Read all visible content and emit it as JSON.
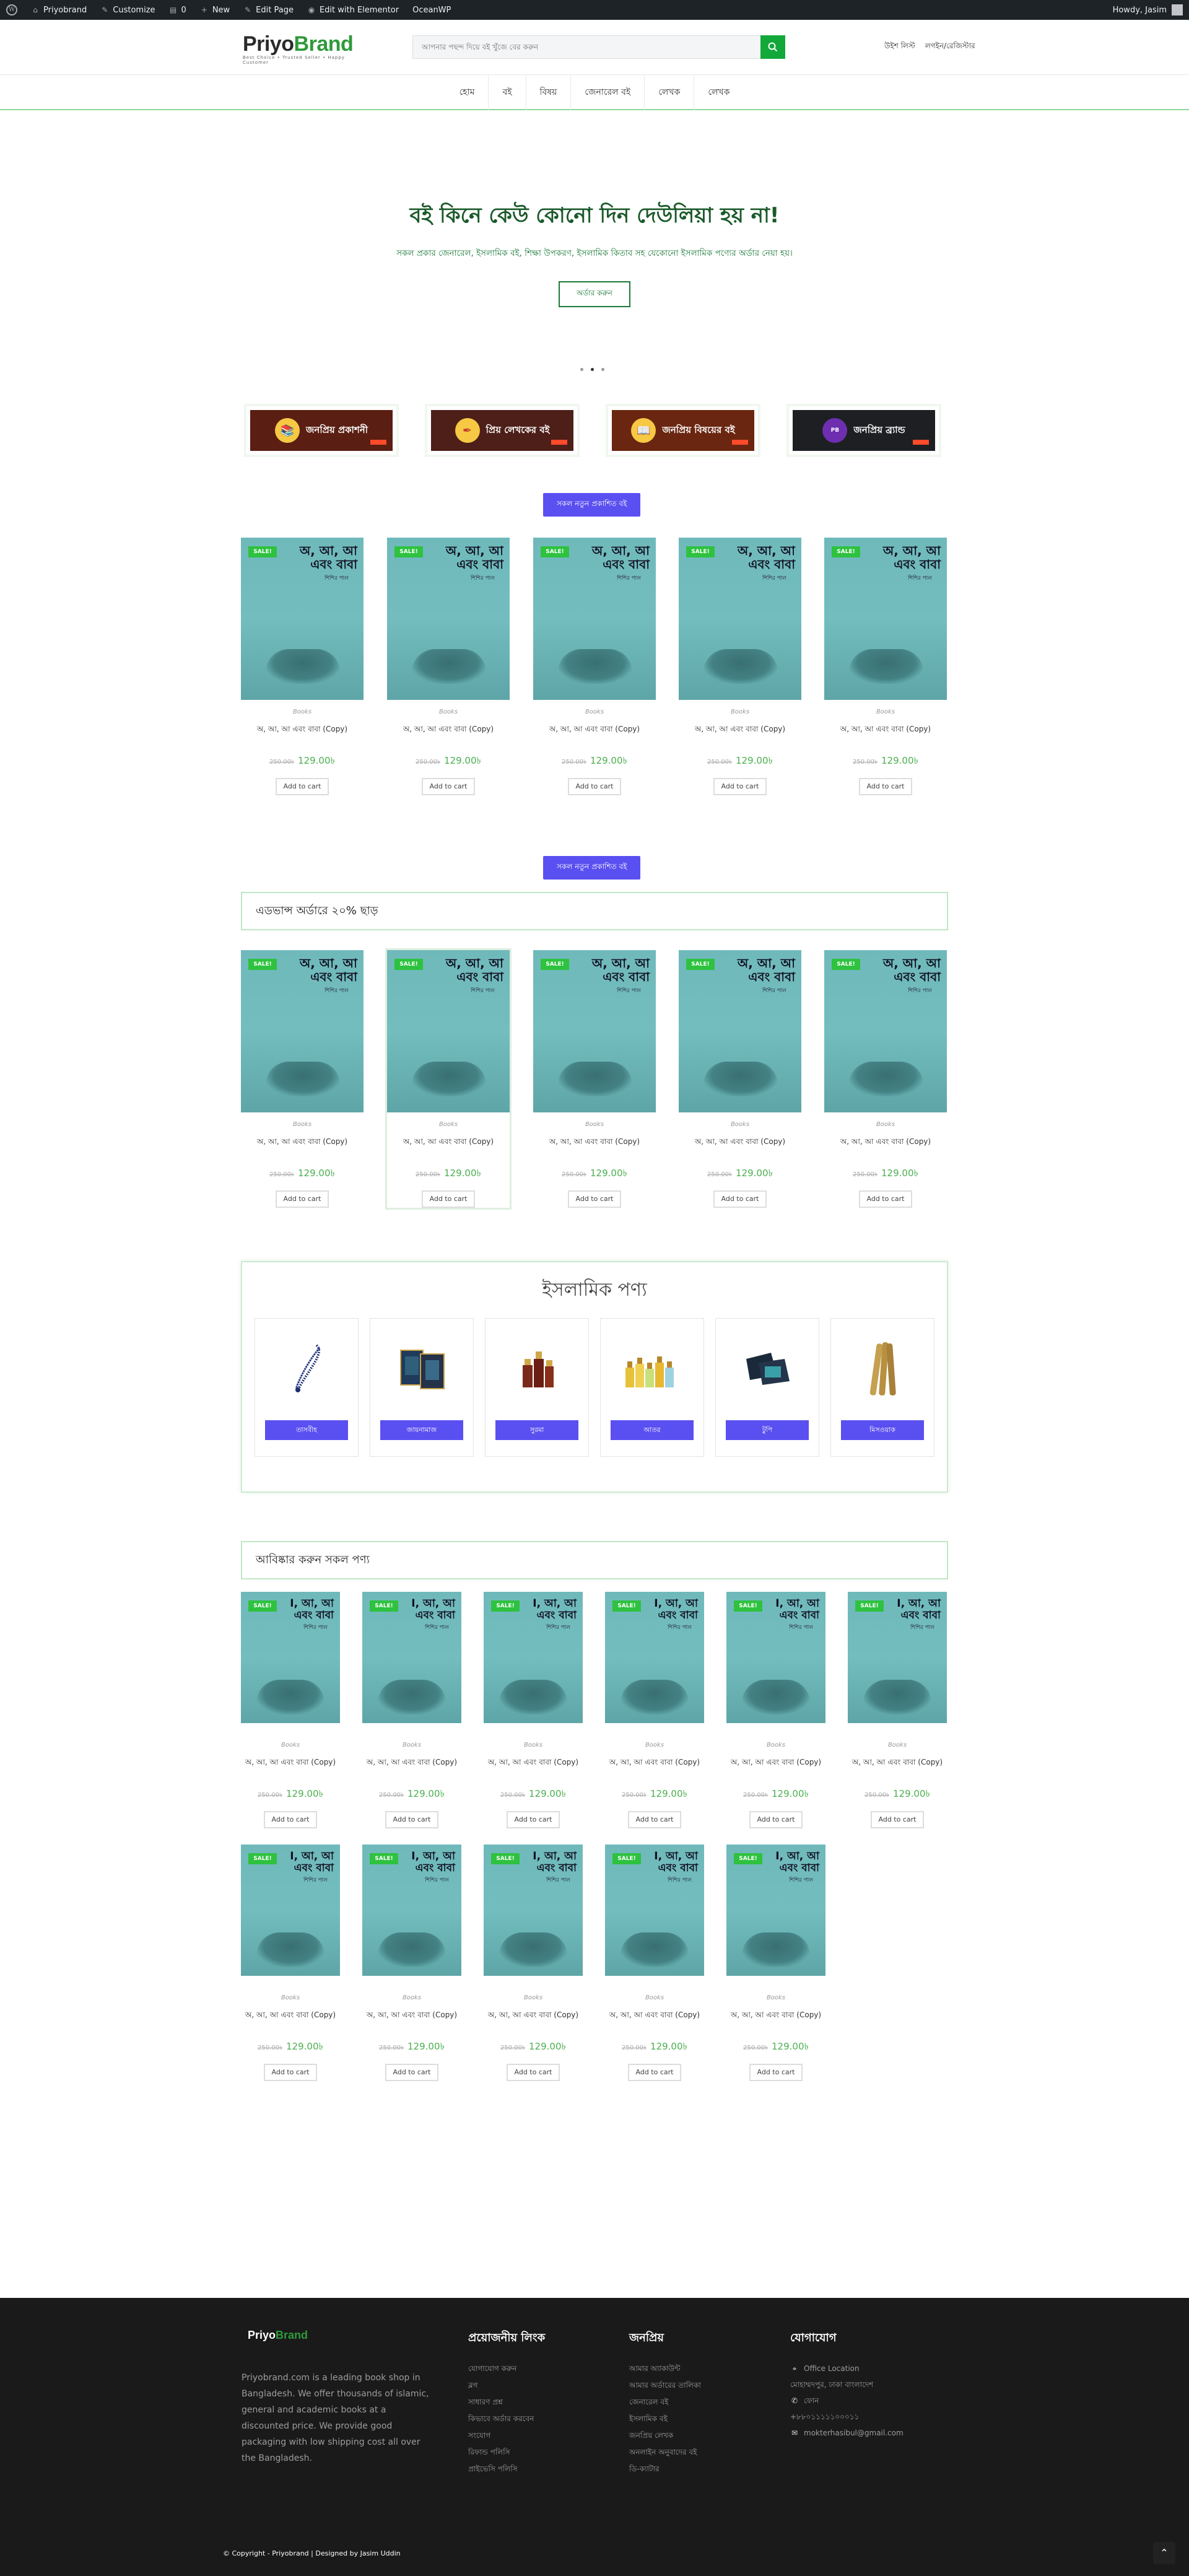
{
  "adminbar": {
    "site": "Priyobrand",
    "customize": "Customize",
    "comments": "0",
    "new": "New",
    "edit_page": "Edit Page",
    "elementor": "Edit with Elementor",
    "theme": "OceanWP",
    "howdy": "Howdy, Jasim"
  },
  "header": {
    "logo_main": "Priyo",
    "logo_b": "Brand",
    "logo_tag": "Best Choice  •  Trusted Seller  •  Happy Customer",
    "search_placeholder": "আপনার পছন্দ দিয়ে বই খুঁজে বের করুন",
    "link_wishlist": "উইশ লিস্ট",
    "link_login": "লগইন/রেজিস্টার"
  },
  "nav": [
    "হোম",
    "বই",
    "বিষয়",
    "জেনারেল বই",
    "লেখক",
    "লেখক"
  ],
  "hero": {
    "title": "বই কিনে কেউ কোনো দিন দেউলিয়া হয় না!",
    "subtitle": "সকল প্রকার জেনারেল, ইসলামিক বই, শিক্ষা উপকরণ, ইসলামিক কিতাব সহ যেকোনো ইসলামিক পণ্যের অর্ডার নেয়া হয়।",
    "button": "অর্ডার করুন"
  },
  "categories": [
    {
      "label": "জনপ্রিয় প্রকাশনী",
      "bg": "#5a1e12",
      "icon": "book-icon"
    },
    {
      "label": "প্রিয় লেখকের বই",
      "bg": "#4d1f18",
      "icon": "pen-icon"
    },
    {
      "label": "জনপ্রিয় বিষয়ের বই",
      "bg": "#6a2610",
      "icon": "books-icon"
    },
    {
      "label": "জনপ্রিয় ব্র্যান্ড",
      "bg": "#1d1f22",
      "icon": "brand-icon"
    }
  ],
  "sections": {
    "pill1": "সকল নতুন প্রকাশিত বই",
    "pill2": "সকল নতুন প্রকাশিত বই",
    "advance_bar": "এডভান্স অর্ডারে ২০% ছাড়",
    "all_products_bar": "আবিষ্কার করুন সকল পণ্য"
  },
  "product": {
    "sale": "SALE!",
    "cover_title": "অ, আ, আ এবং বাবা",
    "cover_title_sm": "I, আ, আ এবং বাবা",
    "cover_sub": "শিশির পাল",
    "category": "Books",
    "name": "অ, আ, আ এবং বাবা (Copy)",
    "old_price": "250.00৳",
    "price": "129.00৳",
    "add_to_cart": "Add to cart"
  },
  "islamic": {
    "title": "ইসলামিক পণ্য",
    "items": [
      {
        "label": "তাসবীহ",
        "icon": "tasbih-icon"
      },
      {
        "label": "জায়নামাজ",
        "icon": "prayer-mat-icon"
      },
      {
        "label": "সুরমা",
        "icon": "surma-icon"
      },
      {
        "label": "আতর",
        "icon": "attar-icon"
      },
      {
        "label": "টুপি",
        "icon": "cap-icon"
      },
      {
        "label": "মিসওয়াক",
        "icon": "miswak-icon"
      }
    ]
  },
  "footer": {
    "logo_main": "Priyo",
    "logo_b": "Brand",
    "description": "Priyobrand.com  is a leading book shop in Bangladesh. We offer thousands of islamic, general and academic books at a discounted price. We provide good packaging with low shipping cost all over the Bangladesh.",
    "col1_title": "প্রয়োজনীয় লিংক",
    "col1_links": [
      "যোগাযোগ করুন",
      "ব্লগ",
      "সাধারণ প্রশ্ন",
      "কিভাবে অর্ডার করবেন",
      "সংযোগ",
      "রিফান্ড পলিসি",
      "প্রাইভেসি পলিসি"
    ],
    "col2_title": "জনপ্রিয়",
    "col2_links": [
      "আমার অ্যাকাউন্ট",
      "আমার অর্ডারের তালিকা",
      "জেনারেল বই",
      "ইসলামিক বই",
      "জনপ্রিয় লেখক",
      "অনলাইন অনুবাদের বই",
      "ডি-ক্যাটার"
    ],
    "col3_title": "যোগাযোগ",
    "office_label": "Office Location",
    "office_addr": "মোহাম্মদপুর, ঢাকা বাংলাদেশ",
    "phone_label": "ফোন",
    "phone": "+৮৮০১১১১১০০০১১",
    "email": "mokterhasibul@gmail.com",
    "copyright": "© Copyright - Priyobrand | Designed by Jasim Uddin"
  }
}
